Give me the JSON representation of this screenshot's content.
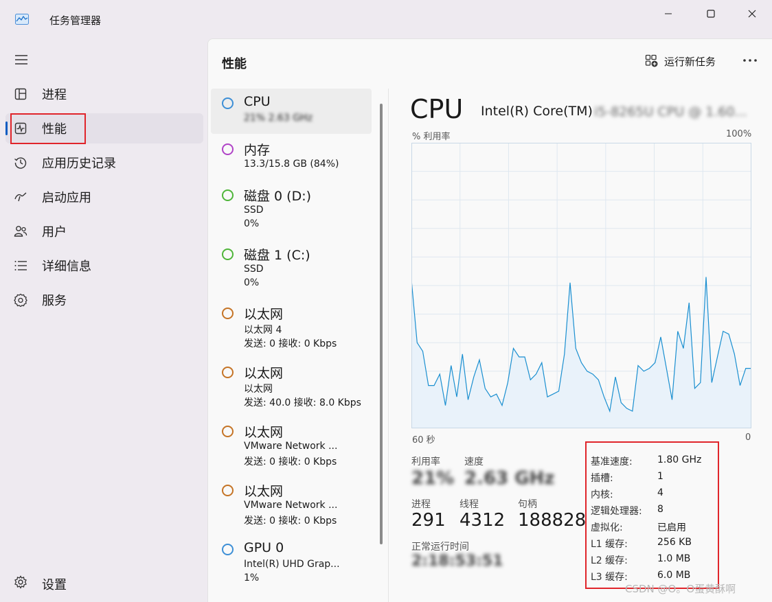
{
  "window": {
    "title": "任务管理器"
  },
  "sidebar": {
    "items": [
      {
        "label": "进程",
        "icon": "processes-icon"
      },
      {
        "label": "性能",
        "icon": "performance-icon"
      },
      {
        "label": "应用历史记录",
        "icon": "history-icon"
      },
      {
        "label": "启动应用",
        "icon": "startup-icon"
      },
      {
        "label": "用户",
        "icon": "users-icon"
      },
      {
        "label": "详细信息",
        "icon": "details-icon"
      },
      {
        "label": "服务",
        "icon": "services-icon"
      }
    ],
    "settings_label": "设置"
  },
  "header": {
    "title": "性能",
    "run_task_label": "运行新任务",
    "more_label": "···"
  },
  "devices": [
    {
      "name": "CPU",
      "sub1": "21% 2.63 GHz",
      "sub2": "",
      "color": "#3d8fd6"
    },
    {
      "name": "内存",
      "sub1": "13.3/15.8 GB (84%)",
      "sub2": "",
      "color": "#b043c7"
    },
    {
      "name": "磁盘 0 (D:)",
      "sub1": "SSD",
      "sub2": "0%",
      "color": "#4fb53a"
    },
    {
      "name": "磁盘 1 (C:)",
      "sub1": "SSD",
      "sub2": "0%",
      "color": "#4fb53a"
    },
    {
      "name": "以太网",
      "sub1": "以太网 4",
      "sub2": "发送: 0 接收: 0 Kbps",
      "color": "#c57426"
    },
    {
      "name": "以太网",
      "sub1": "以太网",
      "sub2": "发送: 40.0 接收: 8.0 Kbps",
      "color": "#c57426"
    },
    {
      "name": "以太网",
      "sub1": "VMware Network ...",
      "sub2": "发送: 0 接收: 0 Kbps",
      "color": "#c57426"
    },
    {
      "name": "以太网",
      "sub1": "VMware Network ...",
      "sub2": "发送: 0 接收: 0 Kbps",
      "color": "#c57426"
    },
    {
      "name": "GPU 0",
      "sub1": "Intel(R) UHD Grap...",
      "sub2": "1%",
      "color": "#3d8fd6"
    }
  ],
  "cpu": {
    "title": "CPU",
    "model_visible": "Intel(R) Core(TM)",
    "model_obscured": "i5-8265U CPU @ 1.60...",
    "util_label": "% 利用率",
    "max_label": "100%",
    "time_left": "60 秒",
    "time_right": "0",
    "stats": {
      "utilization_label": "利用率",
      "utilization_value": "21%",
      "speed_label": "速度",
      "speed_value": "2.63 GHz",
      "processes_label": "进程",
      "processes_value": "291",
      "threads_label": "线程",
      "threads_value": "4312",
      "handles_label": "句柄",
      "handles_value": "188828",
      "uptime_label": "正常运行时间",
      "uptime_value": "2:18:53:51"
    },
    "specs": [
      {
        "label": "基准速度:",
        "value": "1.80 GHz"
      },
      {
        "label": "插槽:",
        "value": "1"
      },
      {
        "label": "内核:",
        "value": "4"
      },
      {
        "label": "逻辑处理器:",
        "value": "8"
      },
      {
        "label": "虚拟化:",
        "value": "已启用"
      },
      {
        "label": "L1 缓存:",
        "value": "256 KB"
      },
      {
        "label": "L2 缓存:",
        "value": "1.0 MB"
      },
      {
        "label": "L3 缓存:",
        "value": "6.0 MB"
      }
    ]
  },
  "chart_data": {
    "type": "area",
    "ylim": [
      0,
      100
    ],
    "x": [
      0,
      1,
      2,
      3,
      4,
      5,
      6,
      7,
      8,
      9,
      10,
      11,
      12,
      13,
      14,
      15,
      16,
      17,
      18,
      19,
      20,
      21,
      22,
      23,
      24,
      25,
      26,
      27,
      28,
      29,
      30,
      31,
      32,
      33,
      34,
      35,
      36,
      37,
      38,
      39,
      40,
      41,
      42,
      43,
      44,
      45,
      46,
      47,
      48,
      49,
      50,
      51,
      52,
      53,
      54,
      55,
      56,
      57,
      58,
      59,
      60
    ],
    "values": [
      52,
      30,
      27,
      15,
      15,
      19,
      8,
      22,
      11,
      26,
      10,
      18,
      24,
      14,
      11,
      12,
      8,
      16,
      28,
      25,
      25,
      17,
      19,
      23,
      11,
      12,
      13,
      26,
      51,
      28,
      23,
      20,
      19,
      17,
      11,
      6,
      18,
      9,
      7,
      6,
      22,
      20,
      21,
      23,
      32,
      21,
      10,
      34,
      28,
      44,
      14,
      16,
      53,
      16,
      25,
      34,
      33,
      26,
      15,
      21,
      21
    ],
    "series_color": "#1a8fd0"
  },
  "watermark": "CSDN @O。O蛋黄酥啊",
  "colors": {
    "accent": "#0b5cc1",
    "highlight_box": "#e0242a"
  }
}
